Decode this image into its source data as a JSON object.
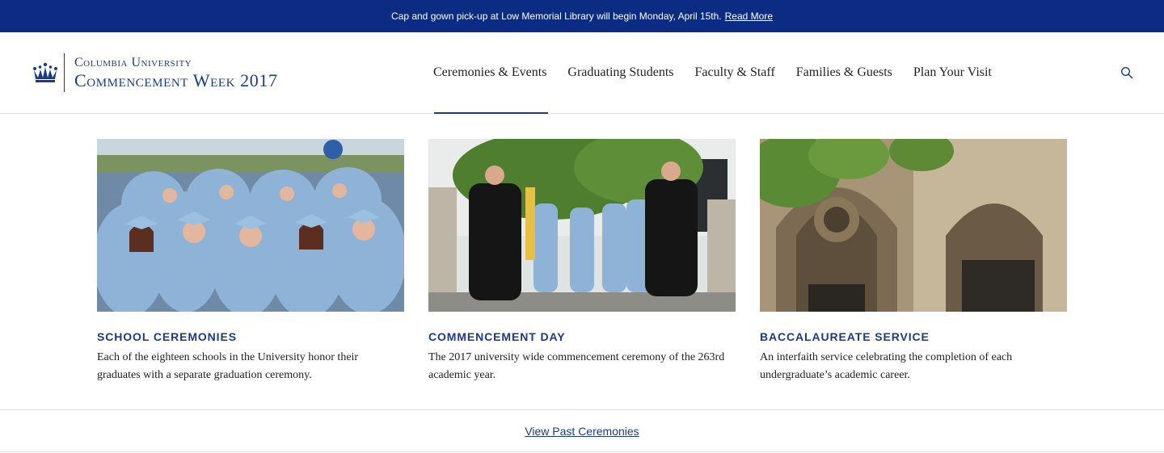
{
  "announcement": {
    "text": "Cap and gown pick-up at Low Memorial Library will begin Monday, April 15th.",
    "link": "Read More"
  },
  "brand": {
    "line1": "Columbia University",
    "line2": "Commencement Week 2017",
    "icon": "crown-icon",
    "color": "#1b3a8a"
  },
  "nav": {
    "items": [
      {
        "label": "Ceremonies & Events",
        "active": true
      },
      {
        "label": "Graduating Students",
        "active": false
      },
      {
        "label": "Faculty & Staff",
        "active": false
      },
      {
        "label": "Families & Guests",
        "active": false
      },
      {
        "label": "Plan Your Visit",
        "active": false
      }
    ],
    "search_icon": "search-icon"
  },
  "cards": [
    {
      "title": "SCHOOL CEREMONIES",
      "description": "Each of the eighteen schools in the University honor their graduates with a separate graduation ceremony."
    },
    {
      "title": "COMMENCEMENT DAY",
      "description": "The 2017 university wide commencement ceremony of the 263rd academic year."
    },
    {
      "title": "BACCALAUREATE SERVICE",
      "description": "An interfaith service celebrating the completion of each undergraduate’s academic career."
    }
  ],
  "footer_link": "View Past Ceremonies",
  "colors": {
    "banner": "#0b2c82",
    "accent": "#1b3a8a",
    "gown": "#8fb3d6"
  }
}
